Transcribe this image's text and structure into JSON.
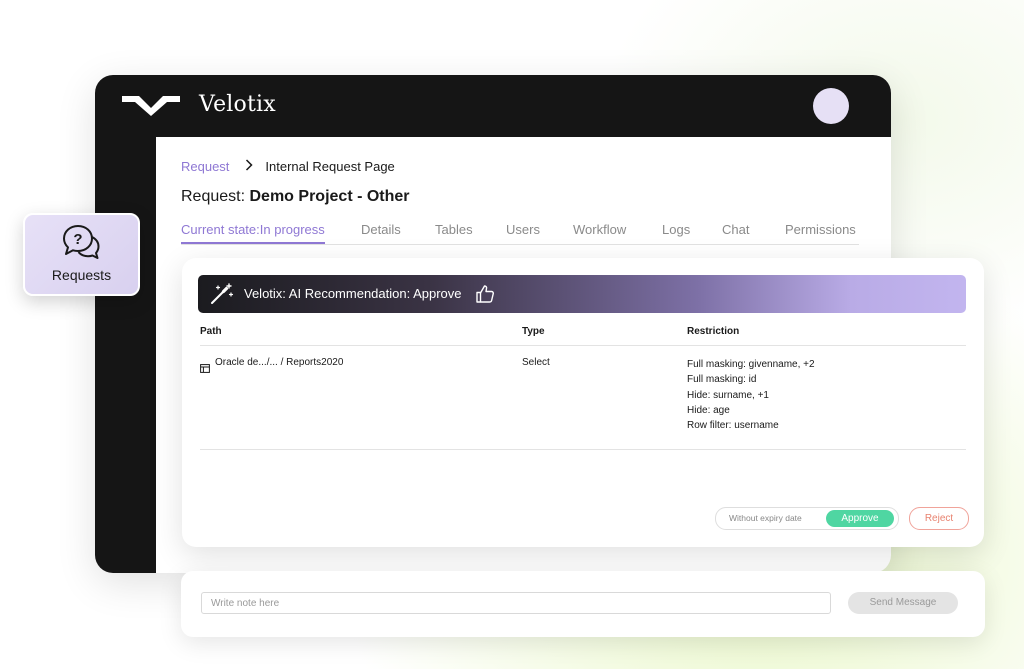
{
  "app": {
    "brand": "Velotix",
    "logo_icon": "velotix-logo-mark",
    "avatar_icon": "user-avatar"
  },
  "breadcrumb": {
    "parent": "Request",
    "separator_icon": "chevron-right-icon",
    "current": "Internal Request Page"
  },
  "page": {
    "title_prefix": "Request:",
    "title_name": "Demo Project - Other"
  },
  "tabs": [
    {
      "label": "Current state:In progress",
      "active": true
    },
    {
      "label": "Details"
    },
    {
      "label": "Tables"
    },
    {
      "label": "Users"
    },
    {
      "label": "Workflow"
    },
    {
      "label": "Logs"
    },
    {
      "label": "Chat"
    },
    {
      "label": "Permissions"
    }
  ],
  "requests_badge": {
    "label": "Requests",
    "icon": "question-chat-icon",
    "bg_color": "#e3ddf5"
  },
  "recommendation": {
    "text": "Velotix: AI Recommendation: Approve",
    "icon_left": "magic-wand-icon",
    "icon_right": "thumbs-up-icon"
  },
  "table": {
    "columns": [
      "Path",
      "Type",
      "Restriction"
    ],
    "rows": [
      {
        "path": "Oracle de.../... / Reports2020",
        "type": "Select",
        "restrictions": [
          "Full masking: givenname, +2",
          "Full masking: id",
          "Hide: surname, +1",
          "Hide: age",
          "Row filter: username"
        ]
      }
    ]
  },
  "actions": {
    "expiry_label": "Without expiry date",
    "approve_label": "Approve",
    "reject_label": "Reject",
    "approve_color": "#4fd6a2",
    "reject_color": "#e8826f"
  },
  "note": {
    "placeholder": "Write note here",
    "send_label": "Send Message"
  },
  "colors": {
    "accent": "#8f78d4",
    "topbar": "#151515"
  }
}
